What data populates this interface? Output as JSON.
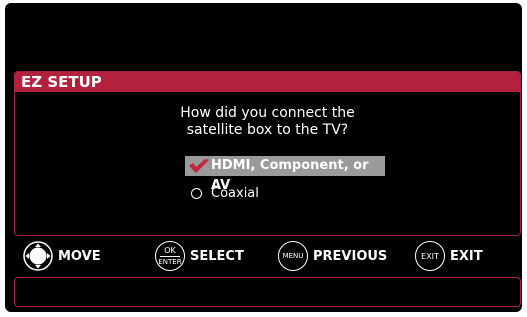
{
  "panel": {
    "title": "EZ SETUP",
    "question_line1": "How did you connect the",
    "question_line2": "satellite box to the TV?",
    "options": [
      {
        "label": "HDMI, Component, or AV",
        "selected": true,
        "icon": "checkmark-icon"
      },
      {
        "label": "Coaxial",
        "selected": false,
        "icon": "radio-icon"
      }
    ]
  },
  "controls": {
    "move": {
      "label": "MOVE",
      "icon": "dpad-icon"
    },
    "select": {
      "label": "SELECT",
      "button_top": "OK",
      "button_bottom": "ENTER"
    },
    "previous": {
      "label": "PREVIOUS",
      "button": "MENU"
    },
    "exit": {
      "label": "EXIT",
      "button": "EXIT"
    }
  },
  "colors": {
    "accent": "#b3213e",
    "checkmark": "#c2273f",
    "highlight": "#9a9a9a",
    "background": "#000000"
  }
}
